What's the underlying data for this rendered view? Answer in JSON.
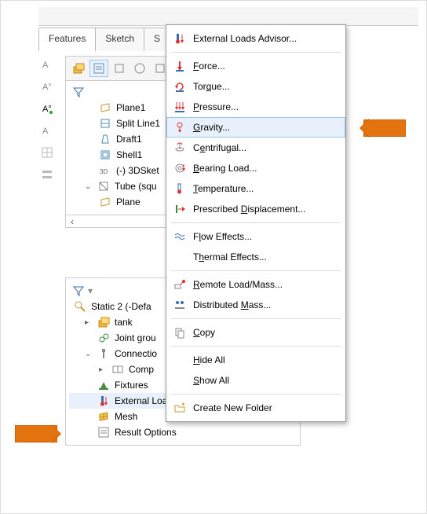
{
  "tabs": {
    "features": "Features",
    "sketch": "Sketch",
    "s_partial": "S"
  },
  "feature_tree": {
    "items": [
      {
        "label": "Plane1"
      },
      {
        "label": "Split Line1"
      },
      {
        "label": "Draft1"
      },
      {
        "label": "Shell1"
      },
      {
        "label": "(-) 3DSket"
      },
      {
        "label": "Tube (squ"
      },
      {
        "label": "Plane"
      }
    ]
  },
  "sim_tree": {
    "study": "Static 2 (-Defa",
    "items": {
      "tank": "tank",
      "joint_group": "Joint grou",
      "connections": "Connectio",
      "comp": "Comp",
      "fixtures": "Fixtures",
      "external_loads": "External Loads",
      "mesh": "Mesh",
      "result_options": "Result Options"
    }
  },
  "menu": {
    "advisor": "External Loads Advisor...",
    "force": {
      "pre": "",
      "m": "F",
      "post": "orce..."
    },
    "torque": {
      "pre": "Tor",
      "m": "q",
      "post": "ue..."
    },
    "pressure": {
      "pre": "",
      "m": "P",
      "post": "ressure..."
    },
    "gravity": {
      "pre": "",
      "m": "G",
      "post": "ravity..."
    },
    "centrifugal": {
      "pre": "C",
      "m": "e",
      "post": "ntrifugal..."
    },
    "bearing": {
      "pre": "",
      "m": "B",
      "post": "earing Load..."
    },
    "temperature": {
      "pre": "",
      "m": "T",
      "post": "emperature..."
    },
    "displacement": {
      "pre": "Prescribed ",
      "m": "D",
      "post": "isplacement..."
    },
    "flow": {
      "pre": "F",
      "m": "l",
      "post": "ow Effects..."
    },
    "thermal": {
      "pre": "T",
      "m": "h",
      "post": "ermal Effects..."
    },
    "remote": {
      "pre": "",
      "m": "R",
      "post": "emote Load/Mass..."
    },
    "distributed": {
      "pre": "Distributed ",
      "m": "M",
      "post": "ass..."
    },
    "copy": {
      "pre": "",
      "m": "C",
      "post": "opy"
    },
    "hide_all": {
      "pre": "",
      "m": "H",
      "post": "ide All"
    },
    "show_all": {
      "pre": "",
      "m": "S",
      "post": "how All"
    },
    "new_folder": "Create New Folder"
  }
}
